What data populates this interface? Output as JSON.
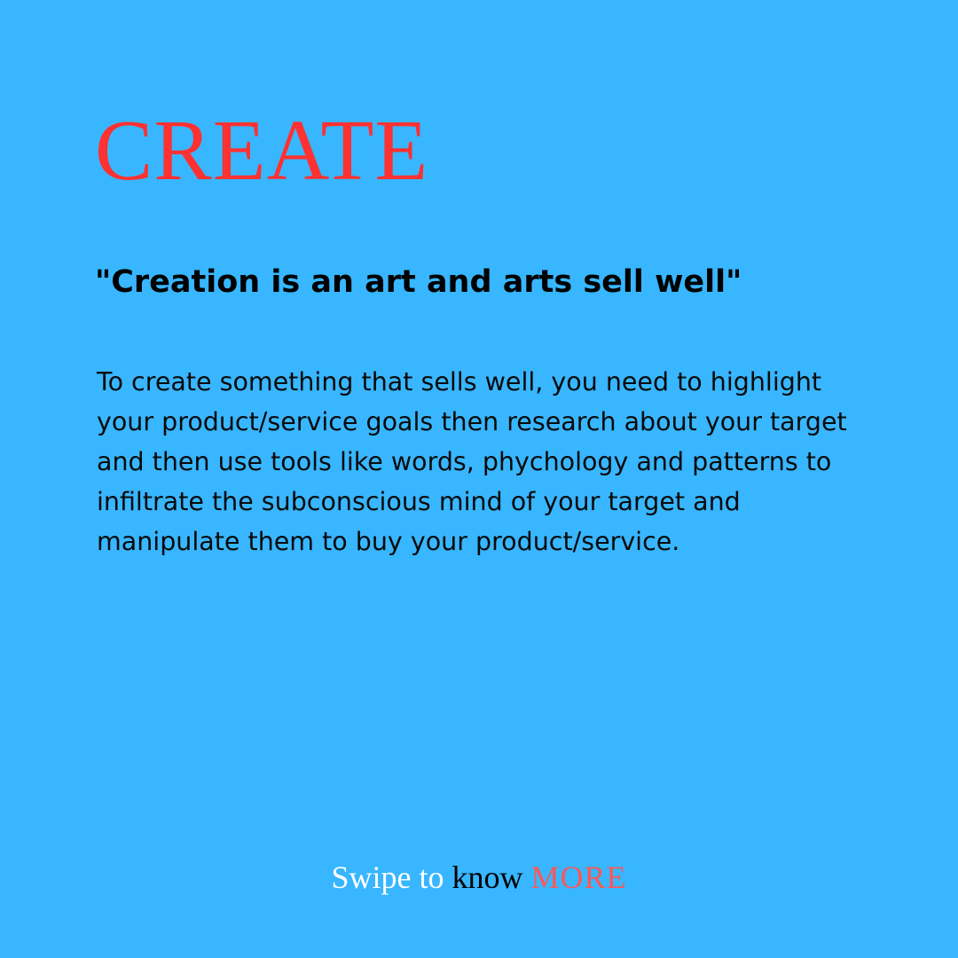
{
  "slide": {
    "title": "CREATE",
    "quote": "\"Creation is an art and arts sell well\"",
    "body": "To create something that sells well, you need to highlight your product/service goals then research about your target and then use tools like words, phychology and patterns to infiltrate the subconscious mind of your target and manipulate them to buy your product/service.",
    "cta": {
      "swipe": "Swipe to",
      "know": "know",
      "more": "MORE"
    }
  },
  "colors": {
    "background": "#38b6ff",
    "title": "#ff3131",
    "cta_more": "#ff5757",
    "cta_swipe": "#ffffff",
    "text": "#000000"
  }
}
